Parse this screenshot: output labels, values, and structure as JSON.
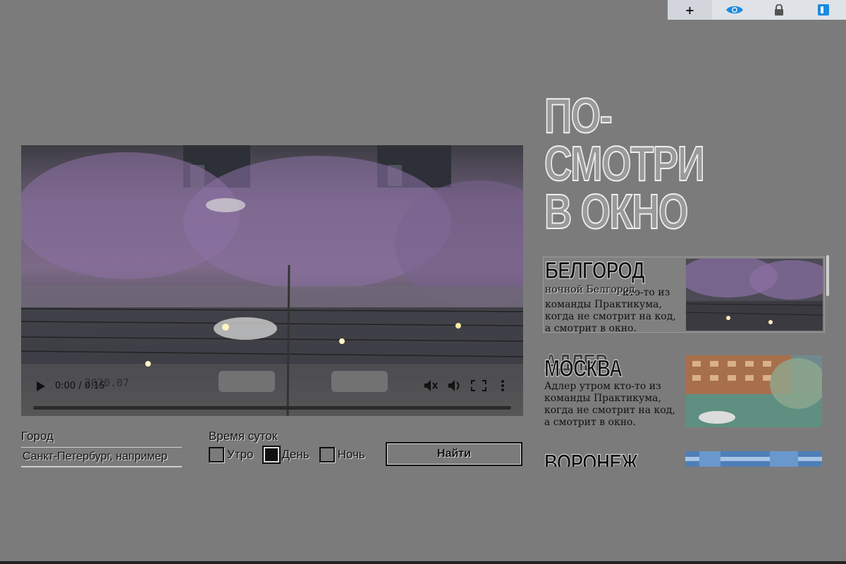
{
  "toolbar": {
    "buttons": [
      {
        "name": "plus-button",
        "icon": "plus-icon",
        "label": "+"
      },
      {
        "name": "preview-button",
        "icon": "eye-icon"
      },
      {
        "name": "lock-button",
        "icon": "lock-icon"
      },
      {
        "name": "panel-button",
        "icon": "panel-icon"
      }
    ],
    "accent": "#1a8be0"
  },
  "video": {
    "time": "0:00 / 0:15",
    "timestamp_overlay": "2020.07"
  },
  "form": {
    "city_label": "Город",
    "city_placeholder": "Санкт-Петербург, например",
    "time_label": "Время суток",
    "options": [
      {
        "label": "Утро",
        "checked": false
      },
      {
        "label": "День",
        "checked": true
      },
      {
        "label": "Ночь",
        "checked": false
      }
    ],
    "submit": "Найти"
  },
  "heading": {
    "lines": [
      "ПО-",
      "СМОТРИ",
      "В ОКНО"
    ]
  },
  "cities": [
    {
      "title": "Белгород",
      "subtitle": "ночной Белгород",
      "description": "кто-то из команды Практикума, когда не смотрит на код, а смотрит в окно.",
      "selected": true
    },
    {
      "title": "Москва",
      "ghost_title": "Адлер",
      "subtitle": "Адлер утром",
      "description": "Адлер утром кто-то из команды Практикума, когда не смотрит на код, а смотрит в окно.",
      "selected": false
    },
    {
      "title": "Воронеж",
      "selected": false
    }
  ]
}
